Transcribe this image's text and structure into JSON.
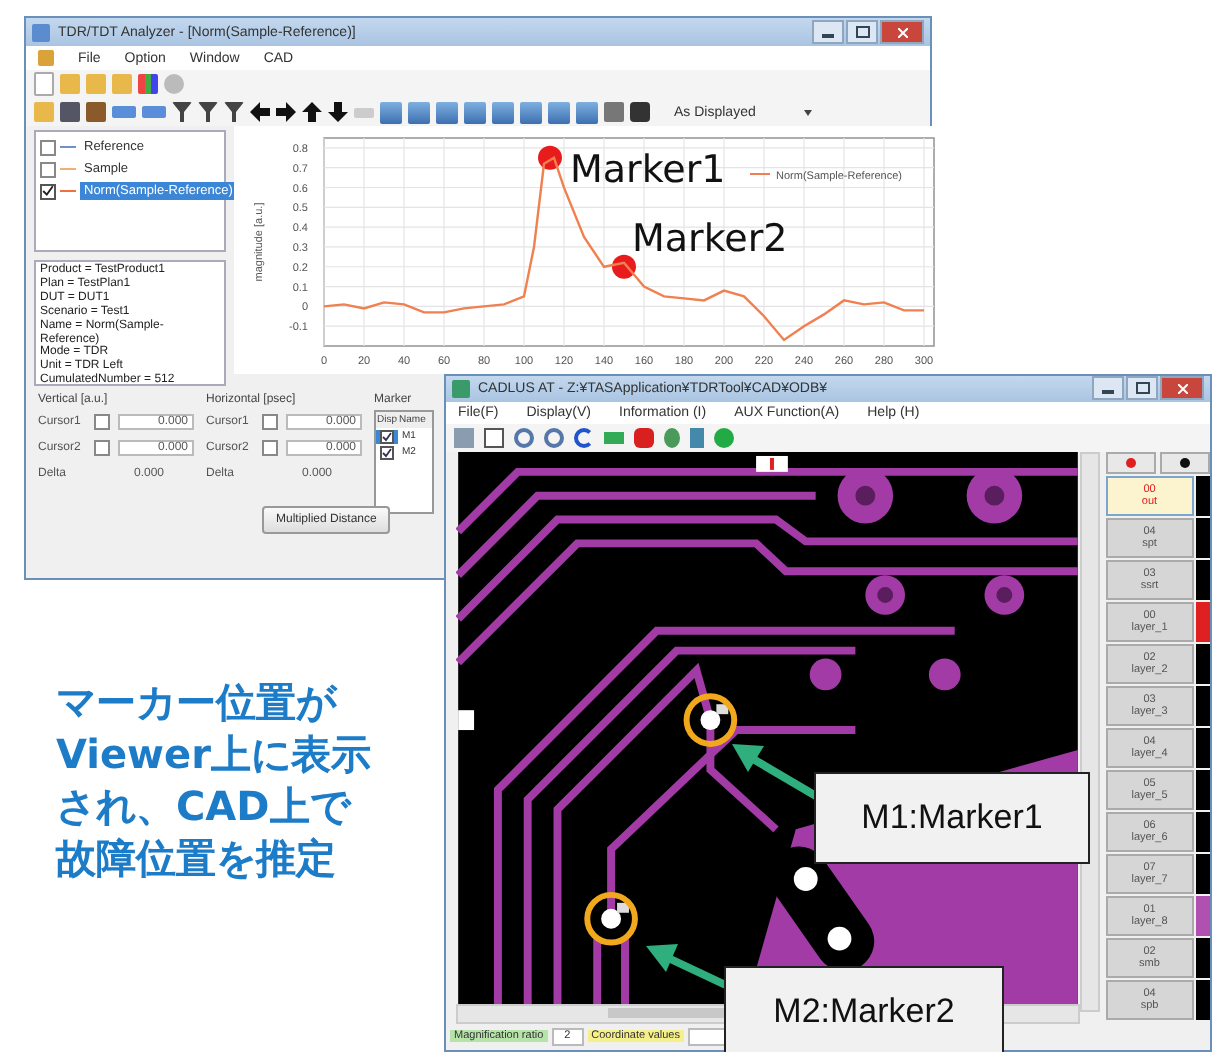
{
  "analyzer_window": {
    "title": "TDR/TDT Analyzer - [Norm(Sample-Reference)]",
    "menu": [
      "File",
      "Option",
      "Window",
      "CAD"
    ],
    "view_option": "As Displayed",
    "traces": [
      {
        "label": "Reference",
        "checked": false,
        "selected": false,
        "color": "#7090d0"
      },
      {
        "label": "Sample",
        "checked": false,
        "selected": false,
        "color": "#f0b070"
      },
      {
        "label": "Norm(Sample-Reference)",
        "checked": true,
        "selected": true,
        "color": "#f07040"
      }
    ],
    "info_lines": [
      "Product = TestProduct1",
      "Plan = TestPlan1",
      "DUT = DUT1",
      "Scenario = Test1",
      "Name = Norm(Sample-",
      "Reference)",
      "Mode = TDR",
      "Unit = TDR Left",
      "CumulatedNumber = 512"
    ],
    "chart": {
      "chart_data": {
        "type": "line",
        "ylabel": "magnitude [a.u.]",
        "x": [
          0,
          10,
          20,
          30,
          40,
          50,
          60,
          70,
          80,
          90,
          100,
          105,
          110,
          115,
          120,
          130,
          140,
          150,
          160,
          170,
          180,
          190,
          200,
          210,
          220,
          230,
          240,
          250,
          260,
          270,
          280,
          290,
          300
        ],
        "series": [
          {
            "name": "Norm(Sample-Reference)",
            "color": "#f08050",
            "values": [
              0,
              0.01,
              -0.01,
              0.02,
              0.01,
              -0.03,
              -0.03,
              -0.01,
              0,
              0.01,
              0.05,
              0.3,
              0.72,
              0.75,
              0.6,
              0.35,
              0.2,
              0.22,
              0.1,
              0.05,
              0.04,
              0.03,
              0.08,
              0.05,
              -0.05,
              -0.17,
              -0.1,
              -0.04,
              0.03,
              0.01,
              0.02,
              -0.02,
              -0.02
            ]
          }
        ],
        "xlim": [
          0,
          305
        ],
        "ylim": [
          -0.2,
          0.85
        ],
        "grid": true,
        "xticks": [
          0,
          20,
          40,
          60,
          80,
          100,
          120,
          140,
          160,
          180,
          200,
          220,
          240,
          260,
          280,
          300
        ],
        "yticks": [
          -0.1,
          0,
          0.1,
          0.2,
          0.3,
          0.4,
          0.5,
          0.6,
          0.7,
          0.8
        ],
        "annotations": [
          {
            "text": "Marker1",
            "x": 113,
            "y": 0.75
          },
          {
            "text": "Marker2",
            "x": 150,
            "y": 0.2
          }
        ]
      }
    },
    "cursor_groups": [
      {
        "title": "Vertical [a.u.]",
        "rows": [
          {
            "label": "Cursor1",
            "checked": false,
            "value": "0.000"
          },
          {
            "label": "Cursor2",
            "checked": false,
            "value": "0.000"
          }
        ],
        "delta_label": "Delta",
        "delta": "0.000"
      },
      {
        "title": "Horizontal [psec]",
        "rows": [
          {
            "label": "Cursor1",
            "checked": false,
            "value": "0.000"
          },
          {
            "label": "Cursor2",
            "checked": false,
            "value": "0.000"
          }
        ],
        "delta_label": "Delta",
        "delta": "0.000"
      }
    ],
    "marker": {
      "title": "Marker",
      "columns": [
        "Disp",
        "Name"
      ],
      "rows": [
        {
          "checked": true,
          "name": "M1",
          "selected": true
        },
        {
          "checked": true,
          "name": "M2",
          "selected": false
        }
      ]
    },
    "button": "Multiplied Distance"
  },
  "cad_window": {
    "title": "CADLUS AT - Z:¥TASApplication¥TDRTool¥CAD¥ODB¥",
    "menu": [
      "File(F)",
      "Display(V)",
      "Information (I)",
      "AUX Function(A)",
      "Help (H)"
    ],
    "layers": [
      {
        "number": "00",
        "name": "out",
        "selected": true,
        "color": "#000000"
      },
      {
        "number": "04",
        "name": "spt",
        "selected": false,
        "color": "#000000"
      },
      {
        "number": "03",
        "name": "ssrt",
        "selected": false,
        "color": "#000000"
      },
      {
        "number": "00",
        "name": "layer_1",
        "selected": false,
        "color": "#e02020"
      },
      {
        "number": "02",
        "name": "layer_2",
        "selected": false,
        "color": "#000000"
      },
      {
        "number": "03",
        "name": "layer_3",
        "selected": false,
        "color": "#000000"
      },
      {
        "number": "04",
        "name": "layer_4",
        "selected": false,
        "color": "#000000"
      },
      {
        "number": "05",
        "name": "layer_5",
        "selected": false,
        "color": "#000000"
      },
      {
        "number": "06",
        "name": "layer_6",
        "selected": false,
        "color": "#000000"
      },
      {
        "number": "07",
        "name": "layer_7",
        "selected": false,
        "color": "#000000"
      },
      {
        "number": "01",
        "name": "layer_8",
        "selected": false,
        "color": "#b050b0"
      },
      {
        "number": "02",
        "name": "smb",
        "selected": false,
        "color": "#000000"
      },
      {
        "number": "04",
        "name": "spb",
        "selected": false,
        "color": "#000000"
      }
    ],
    "status": {
      "magnification_label": "Magnification ratio",
      "magnification": "2",
      "coordinate_label": "Coordinate values"
    }
  },
  "caption_lines": [
    "マーカー位置が",
    "Viewer上に表示",
    "され、CAD上で",
    "故障位置を推定"
  ],
  "callouts": [
    "M1:Marker1",
    "M2:Marker2"
  ]
}
